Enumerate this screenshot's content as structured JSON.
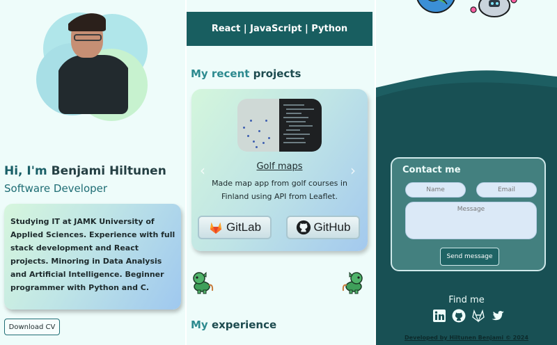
{
  "intro": {
    "greeting_prefix": "Hi, I'm",
    "name": "Benjami Hiltunen",
    "role": "Software Developer",
    "about": "Studying IT at JAMK University of Applied Sciences. Experience with full stack development and React projects. Minoring in Data Analysis and Artificial Intelligence. Beginner programmer with Python and C.",
    "cv_button": "Download CV"
  },
  "tech_bar": "React | JavaScript | Python",
  "projects": {
    "title_accent": "My recent",
    "title_rest": "projects",
    "current": {
      "name": "Golf maps",
      "description": "Made map app from golf courses in Finland using API from Leaflet."
    },
    "prev_arrow": "‹",
    "next_arrow": "›",
    "gitlab_label": "GitLab",
    "github_label": "GitHub"
  },
  "experience": {
    "title_accent": "My",
    "title_rest": "experience"
  },
  "contact": {
    "title": "Contact me",
    "name_placeholder": "Name",
    "email_placeholder": "Email",
    "message_placeholder": "Message",
    "send_button": "Send message"
  },
  "find_me": "Find me",
  "social_icons": [
    "linkedin-icon",
    "github-icon",
    "gitlab-icon",
    "twitter-icon"
  ],
  "footer": "Developed by Hiltunen Benjami © 2024",
  "colors": {
    "primary_teal": "#185e60",
    "accent_teal": "#2d8a8f",
    "background": "#eefcfa",
    "contact_card": "#43807f"
  }
}
